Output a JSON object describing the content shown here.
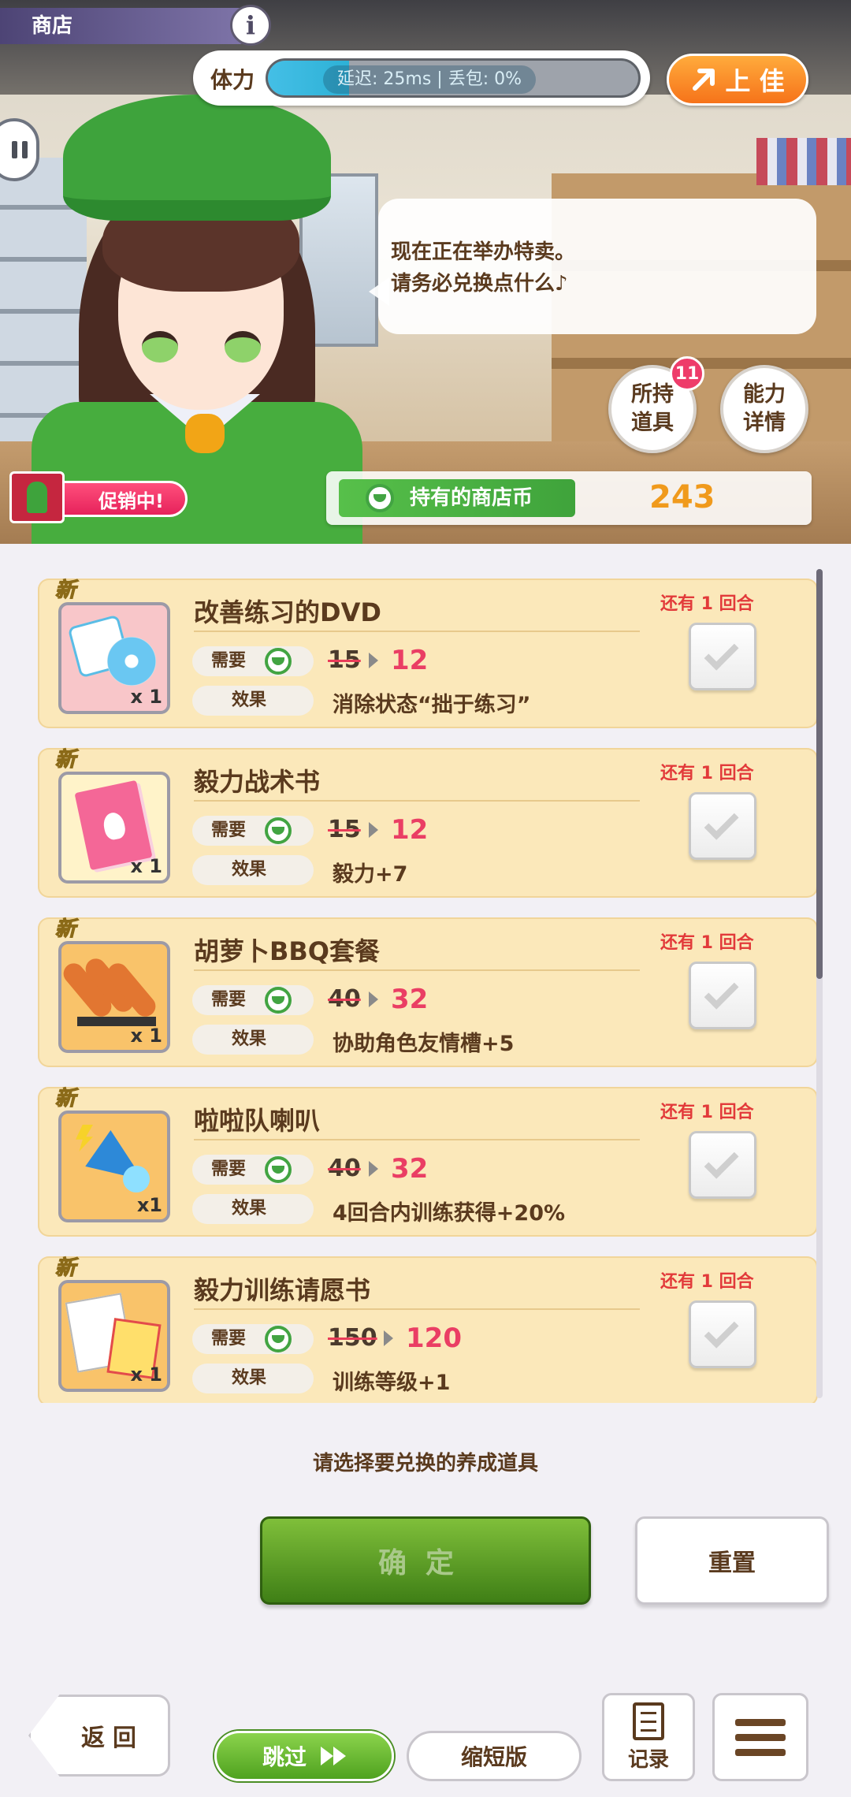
{
  "header": {
    "shop_title": "商店",
    "info_label": "i",
    "stamina_label": "体力",
    "stamina_fraction": 0.22,
    "network_status": "延迟: 25ms | 丢包: 0%",
    "upgrade_label": "上 佳"
  },
  "dialogue": {
    "line1": "现在正在举办特卖。",
    "line2": "请务必兑换点什么♪"
  },
  "side_buttons": {
    "items_label_1": "所持",
    "items_label_2": "道具",
    "items_badge": "11",
    "ability_label_1": "能力",
    "ability_label_2": "详情"
  },
  "promo_label": "促销中!",
  "coins": {
    "label": "持有的商店币",
    "value": "243"
  },
  "item_labels": {
    "need": "需要",
    "effect": "效果",
    "new": "新",
    "remaining": "还有 1 回合"
  },
  "items": [
    {
      "name": "改善练习的DVD",
      "old_price": "15",
      "price": "12",
      "effect": "消除状态“拙于练习”",
      "qty": "x 1",
      "art": "dvd"
    },
    {
      "name": "毅力战术书",
      "old_price": "15",
      "price": "12",
      "effect": "毅力+7",
      "qty": "x 1",
      "art": "book"
    },
    {
      "name": "胡萝卜BBQ套餐",
      "old_price": "40",
      "price": "32",
      "effect": "协助角色友情槽+5",
      "qty": "x 1",
      "art": "bbq"
    },
    {
      "name": "啦啦队喇叭",
      "old_price": "40",
      "price": "32",
      "effect": "4回合内训练获得+20%",
      "qty": "x1",
      "art": "horn"
    },
    {
      "name": "毅力训练请愿书",
      "old_price": "150",
      "price": "120",
      "effect": "训练等级+1",
      "qty": "x 1",
      "art": "request"
    }
  ],
  "footer": {
    "hint": "请选择要兑换的养成道具",
    "confirm": "确定",
    "reset": "重置",
    "back": "返回",
    "skip": "跳过",
    "short": "缩短版",
    "log": "记录"
  },
  "colors": {
    "accent_green": "#3ea33c",
    "price_red": "#ea3e64",
    "coin_orange": "#f09a1c",
    "item_bg": "#fbe8ba"
  }
}
